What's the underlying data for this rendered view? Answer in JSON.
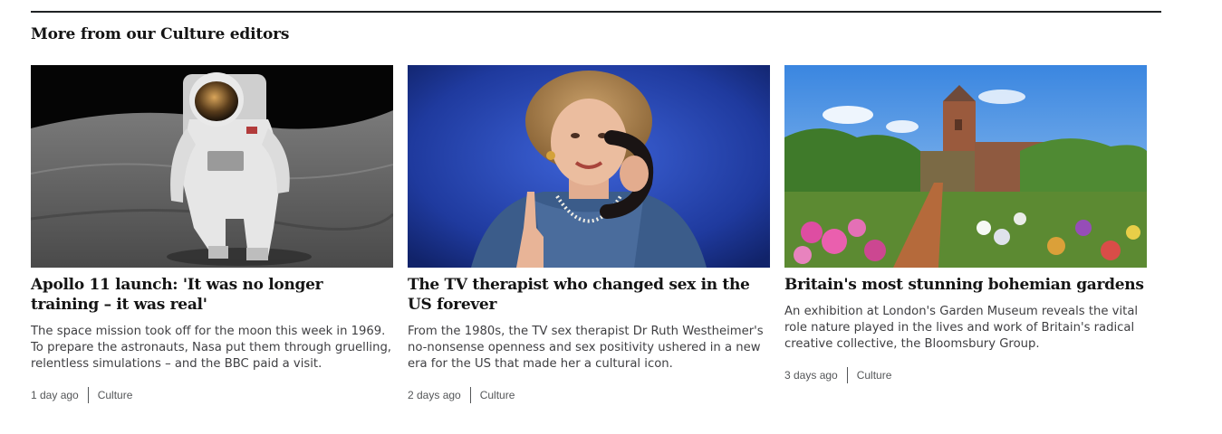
{
  "section": {
    "title": "More from our Culture editors"
  },
  "cards": [
    {
      "headline": "Apollo 11 launch: 'It was no longer training – it was real'",
      "summary": "The space mission took off for the moon this week in 1969. To prepare the astronauts, Nasa put them through gruelling, relentless simulations – and the BBC paid a visit.",
      "time": "1 day ago",
      "category": "Culture",
      "image_alt": "astronaut-on-moon"
    },
    {
      "headline": "The TV therapist who changed sex in the US forever",
      "summary": "From the 1980s, the TV sex therapist Dr Ruth Westheimer's no-nonsense openness and sex positivity ushered in a new era for the US that made her a cultural icon.",
      "time": "2 days ago",
      "category": "Culture",
      "image_alt": "woman-on-telephone"
    },
    {
      "headline": "Britain's most stunning bohemian gardens",
      "summary": "An exhibition at London's Garden Museum reveals the vital role nature played in the lives and work of Britain's radical creative collective, the Bloomsbury Group.",
      "time": "3 days ago",
      "category": "Culture",
      "image_alt": "english-garden"
    }
  ]
}
